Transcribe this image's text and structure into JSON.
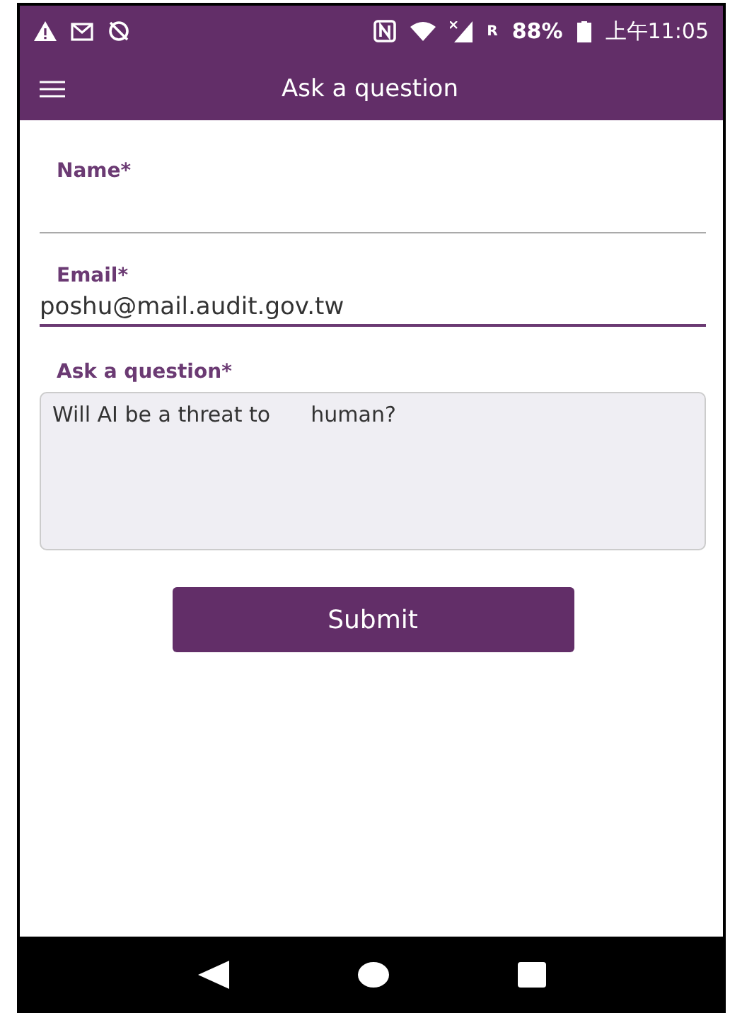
{
  "status_bar": {
    "roaming": "R",
    "battery": "88%",
    "time": "上午11:05"
  },
  "app_bar": {
    "title": "Ask a question"
  },
  "fields": [
    {
      "kind": "line",
      "label": "Name*",
      "focused": false
    },
    {
      "kind": "line",
      "label": "Email*",
      "value": "poshu@mail.audit.gov.tw",
      "focused": true
    },
    {
      "kind": "area",
      "label": "Ask a question*",
      "value": "Will AI be a threat to      human?",
      "focused": false
    }
  ],
  "submit": "Submit"
}
